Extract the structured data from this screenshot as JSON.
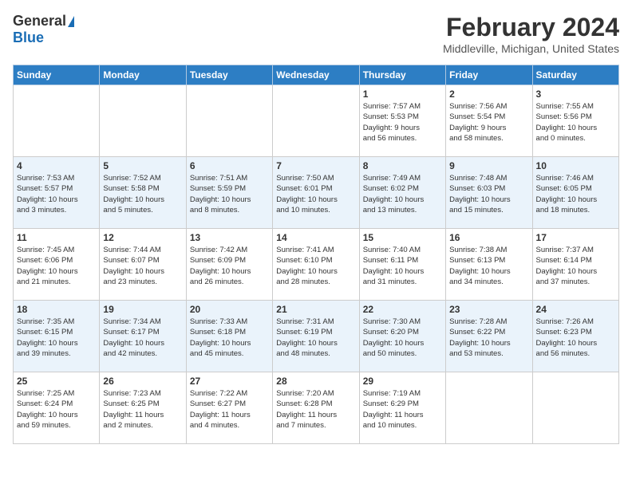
{
  "header": {
    "logo_general": "General",
    "logo_blue": "Blue",
    "title": "February 2024",
    "location": "Middleville, Michigan, United States"
  },
  "days_of_week": [
    "Sunday",
    "Monday",
    "Tuesday",
    "Wednesday",
    "Thursday",
    "Friday",
    "Saturday"
  ],
  "weeks": [
    [
      {
        "day": "",
        "info": ""
      },
      {
        "day": "",
        "info": ""
      },
      {
        "day": "",
        "info": ""
      },
      {
        "day": "",
        "info": ""
      },
      {
        "day": "1",
        "info": "Sunrise: 7:57 AM\nSunset: 5:53 PM\nDaylight: 9 hours\nand 56 minutes."
      },
      {
        "day": "2",
        "info": "Sunrise: 7:56 AM\nSunset: 5:54 PM\nDaylight: 9 hours\nand 58 minutes."
      },
      {
        "day": "3",
        "info": "Sunrise: 7:55 AM\nSunset: 5:56 PM\nDaylight: 10 hours\nand 0 minutes."
      }
    ],
    [
      {
        "day": "4",
        "info": "Sunrise: 7:53 AM\nSunset: 5:57 PM\nDaylight: 10 hours\nand 3 minutes."
      },
      {
        "day": "5",
        "info": "Sunrise: 7:52 AM\nSunset: 5:58 PM\nDaylight: 10 hours\nand 5 minutes."
      },
      {
        "day": "6",
        "info": "Sunrise: 7:51 AM\nSunset: 5:59 PM\nDaylight: 10 hours\nand 8 minutes."
      },
      {
        "day": "7",
        "info": "Sunrise: 7:50 AM\nSunset: 6:01 PM\nDaylight: 10 hours\nand 10 minutes."
      },
      {
        "day": "8",
        "info": "Sunrise: 7:49 AM\nSunset: 6:02 PM\nDaylight: 10 hours\nand 13 minutes."
      },
      {
        "day": "9",
        "info": "Sunrise: 7:48 AM\nSunset: 6:03 PM\nDaylight: 10 hours\nand 15 minutes."
      },
      {
        "day": "10",
        "info": "Sunrise: 7:46 AM\nSunset: 6:05 PM\nDaylight: 10 hours\nand 18 minutes."
      }
    ],
    [
      {
        "day": "11",
        "info": "Sunrise: 7:45 AM\nSunset: 6:06 PM\nDaylight: 10 hours\nand 21 minutes."
      },
      {
        "day": "12",
        "info": "Sunrise: 7:44 AM\nSunset: 6:07 PM\nDaylight: 10 hours\nand 23 minutes."
      },
      {
        "day": "13",
        "info": "Sunrise: 7:42 AM\nSunset: 6:09 PM\nDaylight: 10 hours\nand 26 minutes."
      },
      {
        "day": "14",
        "info": "Sunrise: 7:41 AM\nSunset: 6:10 PM\nDaylight: 10 hours\nand 28 minutes."
      },
      {
        "day": "15",
        "info": "Sunrise: 7:40 AM\nSunset: 6:11 PM\nDaylight: 10 hours\nand 31 minutes."
      },
      {
        "day": "16",
        "info": "Sunrise: 7:38 AM\nSunset: 6:13 PM\nDaylight: 10 hours\nand 34 minutes."
      },
      {
        "day": "17",
        "info": "Sunrise: 7:37 AM\nSunset: 6:14 PM\nDaylight: 10 hours\nand 37 minutes."
      }
    ],
    [
      {
        "day": "18",
        "info": "Sunrise: 7:35 AM\nSunset: 6:15 PM\nDaylight: 10 hours\nand 39 minutes."
      },
      {
        "day": "19",
        "info": "Sunrise: 7:34 AM\nSunset: 6:17 PM\nDaylight: 10 hours\nand 42 minutes."
      },
      {
        "day": "20",
        "info": "Sunrise: 7:33 AM\nSunset: 6:18 PM\nDaylight: 10 hours\nand 45 minutes."
      },
      {
        "day": "21",
        "info": "Sunrise: 7:31 AM\nSunset: 6:19 PM\nDaylight: 10 hours\nand 48 minutes."
      },
      {
        "day": "22",
        "info": "Sunrise: 7:30 AM\nSunset: 6:20 PM\nDaylight: 10 hours\nand 50 minutes."
      },
      {
        "day": "23",
        "info": "Sunrise: 7:28 AM\nSunset: 6:22 PM\nDaylight: 10 hours\nand 53 minutes."
      },
      {
        "day": "24",
        "info": "Sunrise: 7:26 AM\nSunset: 6:23 PM\nDaylight: 10 hours\nand 56 minutes."
      }
    ],
    [
      {
        "day": "25",
        "info": "Sunrise: 7:25 AM\nSunset: 6:24 PM\nDaylight: 10 hours\nand 59 minutes."
      },
      {
        "day": "26",
        "info": "Sunrise: 7:23 AM\nSunset: 6:25 PM\nDaylight: 11 hours\nand 2 minutes."
      },
      {
        "day": "27",
        "info": "Sunrise: 7:22 AM\nSunset: 6:27 PM\nDaylight: 11 hours\nand 4 minutes."
      },
      {
        "day": "28",
        "info": "Sunrise: 7:20 AM\nSunset: 6:28 PM\nDaylight: 11 hours\nand 7 minutes."
      },
      {
        "day": "29",
        "info": "Sunrise: 7:19 AM\nSunset: 6:29 PM\nDaylight: 11 hours\nand 10 minutes."
      },
      {
        "day": "",
        "info": ""
      },
      {
        "day": "",
        "info": ""
      }
    ]
  ]
}
